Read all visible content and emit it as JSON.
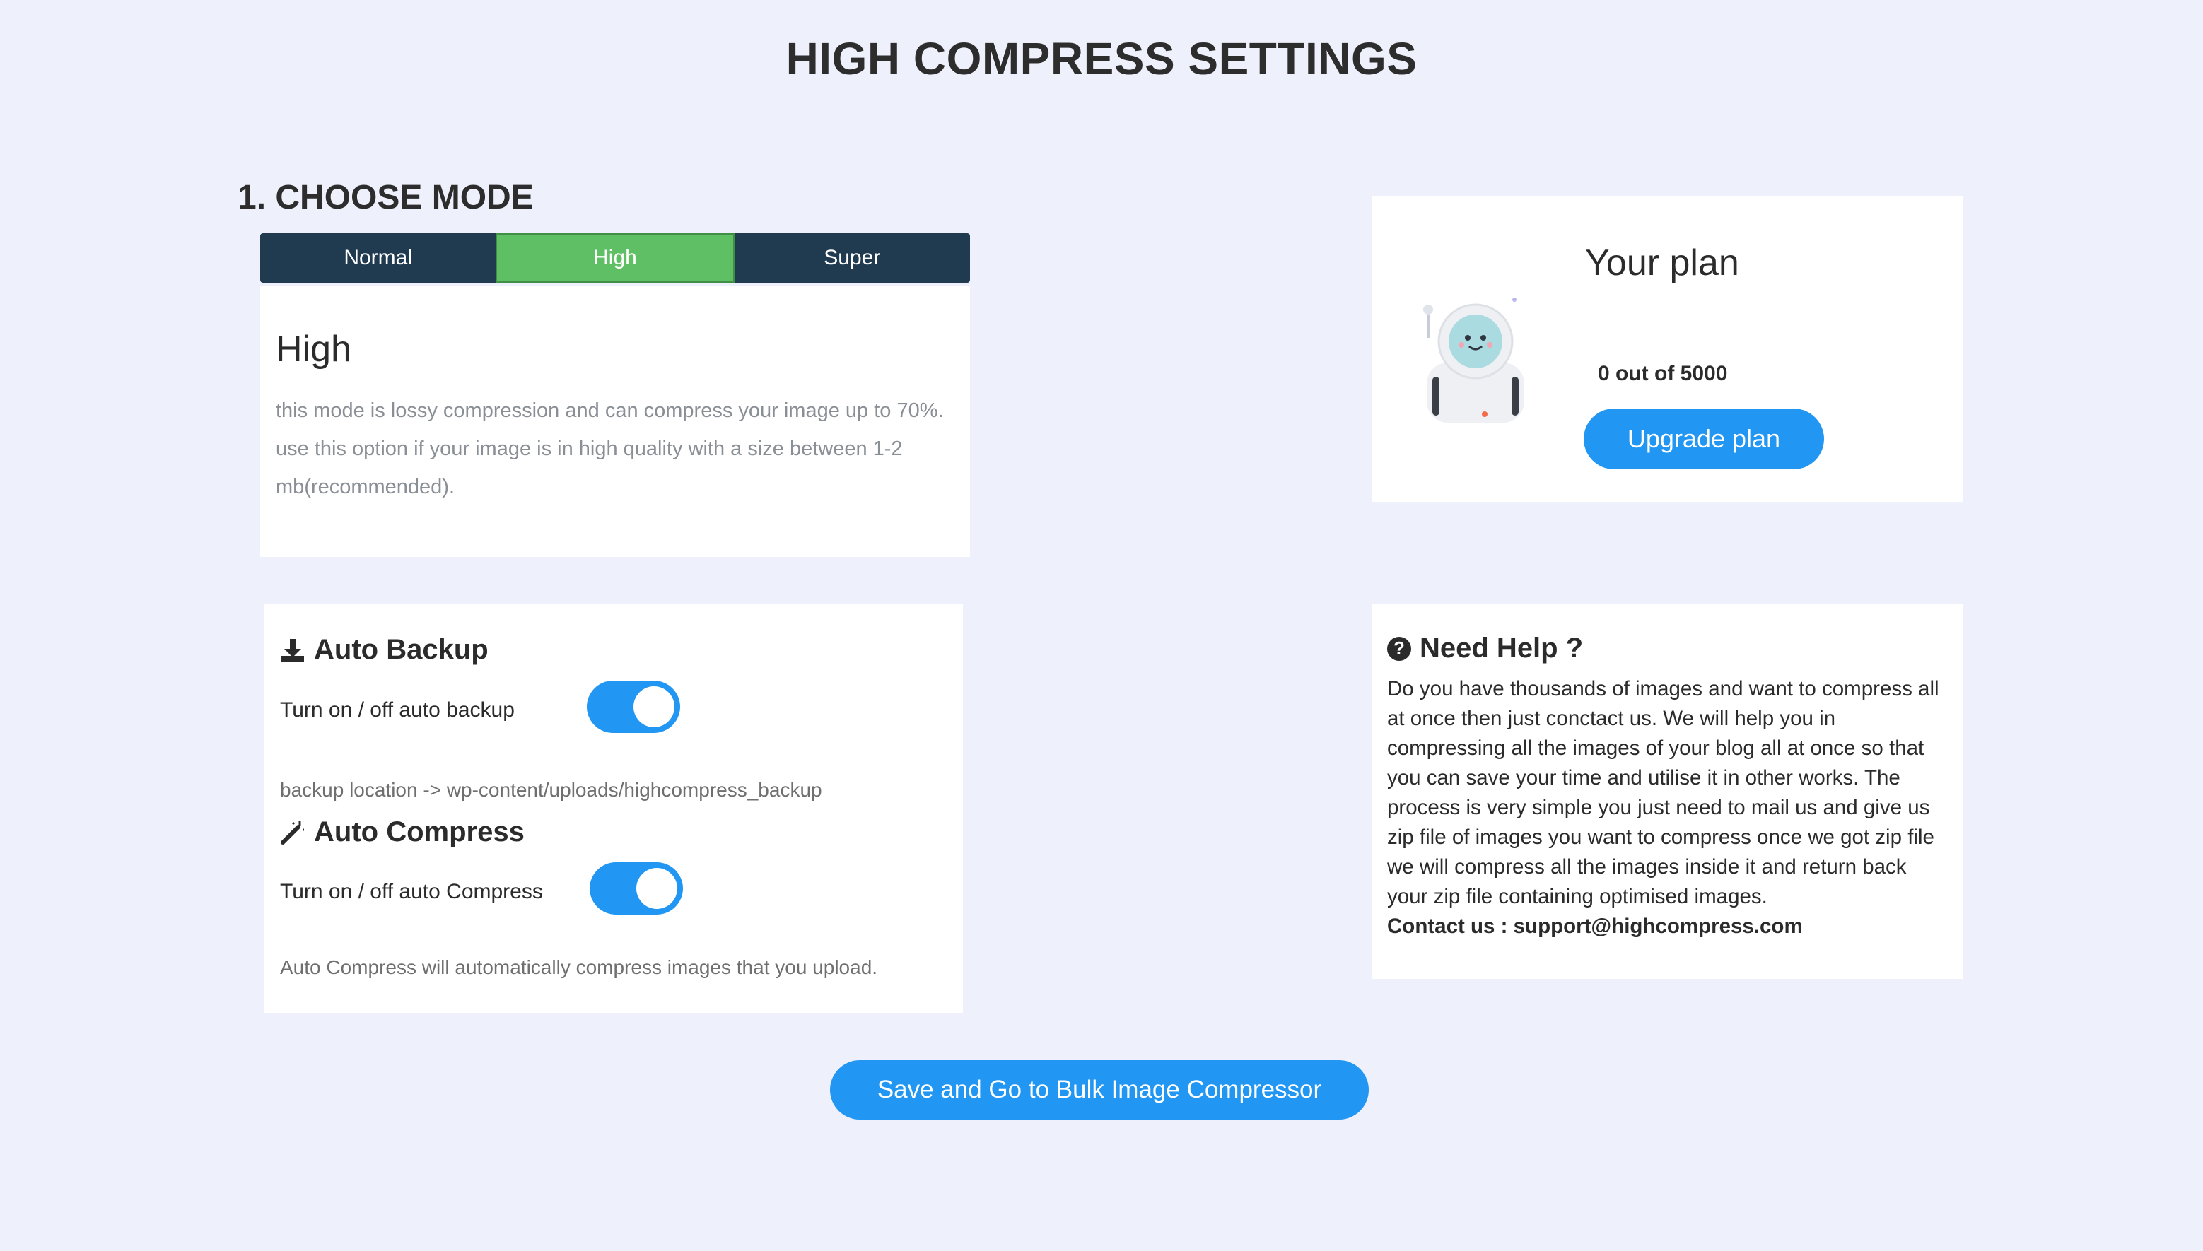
{
  "header": {
    "title": "HIGH COMPRESS SETTINGS"
  },
  "mode": {
    "section_title": "1. CHOOSE MODE",
    "tabs": [
      {
        "label": "Normal",
        "active": false
      },
      {
        "label": "High",
        "active": true
      },
      {
        "label": "Super",
        "active": false
      }
    ],
    "selected_title": "High",
    "description": "this mode is lossy compression and can compress your image up to 70%. use this option if your image is in high quality with a size between 1-2 mb(recommended)."
  },
  "plan": {
    "title": "Your plan",
    "usage": "0 out of 5000",
    "upgrade_label": "Upgrade plan"
  },
  "settings": {
    "auto_backup": {
      "heading": "Auto Backup",
      "label": "Turn on / off auto backup",
      "enabled": true,
      "note": "backup location -> wp-content/uploads/highcompress_backup"
    },
    "auto_compress": {
      "heading": "Auto Compress",
      "label": "Turn on / off auto Compress",
      "enabled": true,
      "note": "Auto Compress will automatically compress images that you upload."
    }
  },
  "help": {
    "heading": "Need Help ?",
    "text": "Do you have thousands of images and want to compress all at once then just conctact us. We will help you in compressing all the images of your blog all at once so that you can save your time and utilise it in other works. The process is very simple you just need to mail us and give us zip file of images you want to compress once we got zip file we will compress all the images inside it and return back your zip file containing optimised images.",
    "contact": "Contact us : support@highcompress.com"
  },
  "footer": {
    "save_label": "Save and Go to Bulk Image Compressor"
  },
  "colors": {
    "background": "#eef0fb",
    "tabs_bg": "#203a4f",
    "tab_active": "#5fbf64",
    "primary": "#2196f3"
  }
}
